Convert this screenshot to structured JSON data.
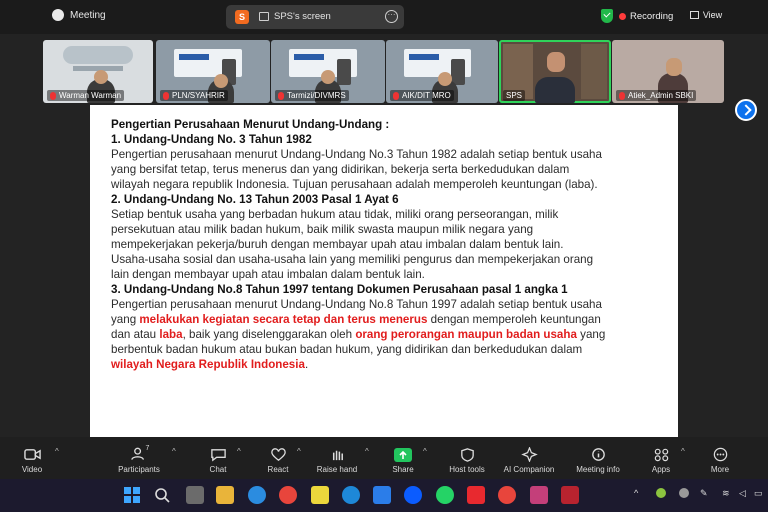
{
  "meeting": {
    "app_title": "Meeting"
  },
  "share": {
    "letter": "S",
    "title": "SPS's screen"
  },
  "status": {
    "recording": "Recording",
    "view": "View"
  },
  "participants": [
    {
      "name": "Warman Warman"
    },
    {
      "name": "PLN/SYAHRIR"
    },
    {
      "name": "Tarmizi/DIVMRS"
    },
    {
      "name": "AIK/DIT MRO"
    },
    {
      "name": "SPS"
    },
    {
      "name": "Atiek_Admin SBKI"
    }
  ],
  "document": {
    "lines": [
      {
        "t": "Pengertian Perusahaan Menurut Undang-Undang :",
        "h": true
      },
      {
        "t": "1. Undang-Undang No. 3 Tahun 1982",
        "h": true
      },
      {
        "t": "Pengertian perusahaan menurut Undang-Undang No.3 Tahun 1982 adalah setiap bentuk usaha"
      },
      {
        "t": "yang bersifat tetap, terus menerus dan yang didirikan, bekerja serta berkedudukan dalam"
      },
      {
        "t": "wilayah negara republik Indonesia. Tujuan perusahaan adalah memperoleh keuntungan (laba)."
      },
      {
        "t": "2. Undang-Undang No. 13 Tahun 2003 Pasal 1 Ayat 6",
        "h": true
      },
      {
        "t": "Setiap bentuk usaha yang berbadan hukum atau tidak, miliki orang perseorangan, milik"
      },
      {
        "t": "persekutuan atau milik badan hukum, baik milik swasta maupun milik negara yang"
      },
      {
        "t": "mempekerjakan pekerja/buruh dengan membayar upah atau imbalan dalam bentuk lain."
      },
      {
        "t": "Usaha-usaha sosial dan usaha-usaha lain yang memiliki pengurus dan mempekerjakan orang"
      },
      {
        "t": "lain dengan membayar upah atau imbalan dalam bentuk lain."
      },
      {
        "t": "3. Undang-Undang No.8 Tahun 1997 tentang Dokumen Perusahaan pasal 1 angka 1",
        "h": true
      },
      {
        "t": "Pengertian perusahaan menurut Undang-Undang No.8 Tahun 1997 adalah setiap bentuk usaha"
      }
    ],
    "rich": [
      [
        {
          "t": "yang "
        },
        {
          "t": "melakukan kegiatan secara tetap dan terus menerus",
          "r": true
        },
        {
          "t": " dengan memperoleh keuntungan"
        }
      ],
      [
        {
          "t": "dan atau "
        },
        {
          "t": "laba",
          "r": true
        },
        {
          "t": ", baik yang diselenggarakan oleh "
        },
        {
          "t": "orang perorangan maupun badan usaha",
          "r": true
        },
        {
          "t": " yang"
        }
      ],
      [
        {
          "t": "berbentuk badan hukum atau bukan badan hukum, yang didirikan dan berkedudukan dalam"
        }
      ],
      [
        {
          "t": "wilayah Negara Republik Indonesia",
          "r": true
        },
        {
          "t": "."
        }
      ]
    ]
  },
  "toolbar": {
    "video": "Video",
    "participants": "Participants",
    "participants_count": "7",
    "chat": "Chat",
    "react": "React",
    "raise_hand": "Raise hand",
    "share": "Share",
    "host_tools": "Host tools",
    "ai_companion": "AI Companion",
    "meeting_info": "Meeting info",
    "apps": "Apps",
    "more": "More"
  },
  "colors": {
    "accent": "#0e72ed",
    "active_speaker": "#2fd35a",
    "highlight_red": "#e11d1d",
    "share_green": "#22c55e"
  }
}
